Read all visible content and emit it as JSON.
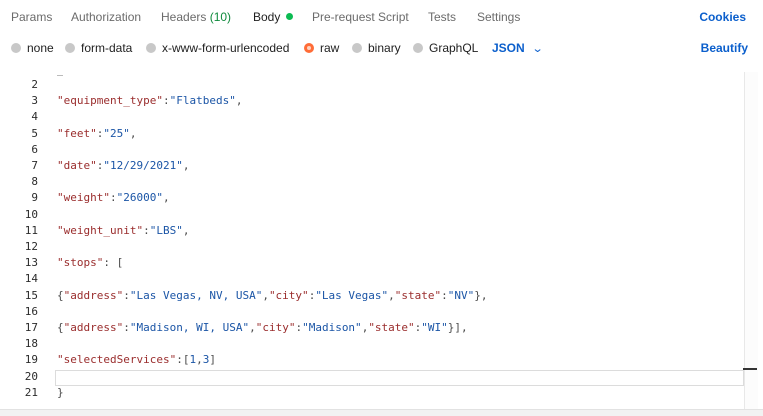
{
  "tabs": [
    {
      "label": "Params"
    },
    {
      "label": "Authorization"
    },
    {
      "label": "Headers",
      "count": "(10)"
    },
    {
      "label": "Body"
    },
    {
      "label": "Pre-request Script"
    },
    {
      "label": "Tests"
    },
    {
      "label": "Settings"
    }
  ],
  "cookies_label": "Cookies",
  "body_options": [
    {
      "label": "none"
    },
    {
      "label": "form-data"
    },
    {
      "label": "x-www-form-urlencoded"
    },
    {
      "label": "raw"
    },
    {
      "label": "binary"
    },
    {
      "label": "GraphQL"
    }
  ],
  "selected_body_option": "raw",
  "format_label": "JSON",
  "beautify_label": "Beautify",
  "colors": {
    "accent": "#ff6c37",
    "link": "#0b5fcc",
    "active_dot": "#0cbb52",
    "headers_count": "#0f8a3c"
  },
  "icons": {
    "format_dropdown": "chevron-down-icon"
  },
  "editor": {
    "line_numbers": [
      "2",
      "3",
      "4",
      "5",
      "6",
      "7",
      "8",
      "9",
      "10",
      "11",
      "12",
      "13",
      "14",
      "15",
      "16",
      "17",
      "18",
      "19",
      "20",
      "21"
    ],
    "lines": [
      [],
      [
        {
          "t": "k",
          "v": "\"equipment_type\""
        },
        {
          "t": "p",
          "v": ":"
        },
        {
          "t": "s",
          "v": "\"Flatbeds\""
        },
        {
          "t": "p",
          "v": ","
        }
      ],
      [],
      [
        {
          "t": "k",
          "v": "\"feet\""
        },
        {
          "t": "p",
          "v": ":"
        },
        {
          "t": "s",
          "v": "\"25\""
        },
        {
          "t": "p",
          "v": ","
        }
      ],
      [],
      [
        {
          "t": "k",
          "v": "\"date\""
        },
        {
          "t": "p",
          "v": ":"
        },
        {
          "t": "s",
          "v": "\"12/29/2021\""
        },
        {
          "t": "p",
          "v": ","
        }
      ],
      [],
      [
        {
          "t": "k",
          "v": "\"weight\""
        },
        {
          "t": "p",
          "v": ":"
        },
        {
          "t": "s",
          "v": "\"26000\""
        },
        {
          "t": "p",
          "v": ","
        }
      ],
      [],
      [
        {
          "t": "k",
          "v": "\"weight_unit\""
        },
        {
          "t": "p",
          "v": ":"
        },
        {
          "t": "s",
          "v": "\"LBS\""
        },
        {
          "t": "p",
          "v": ","
        }
      ],
      [],
      [
        {
          "t": "k",
          "v": "\"stops\""
        },
        {
          "t": "p",
          "v": ": ["
        }
      ],
      [],
      [
        {
          "t": "p",
          "v": "{"
        },
        {
          "t": "k",
          "v": "\"address\""
        },
        {
          "t": "p",
          "v": ":"
        },
        {
          "t": "s",
          "v": "\"Las Vegas, NV, USA\""
        },
        {
          "t": "p",
          "v": ","
        },
        {
          "t": "k",
          "v": "\"city\""
        },
        {
          "t": "p",
          "v": ":"
        },
        {
          "t": "s",
          "v": "\"Las Vegas\""
        },
        {
          "t": "p",
          "v": ","
        },
        {
          "t": "k",
          "v": "\"state\""
        },
        {
          "t": "p",
          "v": ":"
        },
        {
          "t": "s",
          "v": "\"NV\""
        },
        {
          "t": "p",
          "v": "},"
        }
      ],
      [],
      [
        {
          "t": "p",
          "v": "{"
        },
        {
          "t": "k",
          "v": "\"address\""
        },
        {
          "t": "p",
          "v": ":"
        },
        {
          "t": "s",
          "v": "\"Madison, WI, USA\""
        },
        {
          "t": "p",
          "v": ","
        },
        {
          "t": "k",
          "v": "\"city\""
        },
        {
          "t": "p",
          "v": ":"
        },
        {
          "t": "s",
          "v": "\"Madison\""
        },
        {
          "t": "p",
          "v": ","
        },
        {
          "t": "k",
          "v": "\"state\""
        },
        {
          "t": "p",
          "v": ":"
        },
        {
          "t": "s",
          "v": "\"WI\""
        },
        {
          "t": "p",
          "v": "}],"
        }
      ],
      [],
      [
        {
          "t": "k",
          "v": "\"selectedServices\""
        },
        {
          "t": "p",
          "v": ":["
        },
        {
          "t": "n",
          "v": "1"
        },
        {
          "t": "p",
          "v": ","
        },
        {
          "t": "n",
          "v": "3"
        },
        {
          "t": "p",
          "v": "]"
        }
      ],
      [],
      [
        {
          "t": "p",
          "v": "}"
        }
      ]
    ]
  }
}
